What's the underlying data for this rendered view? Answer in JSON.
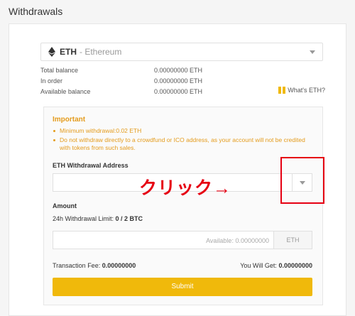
{
  "page": {
    "title": "Withdrawals"
  },
  "coin_select": {
    "code": "ETH",
    "name": "- Ethereum",
    "icon": "ethereum-icon"
  },
  "balances": [
    {
      "label": "Total balance",
      "value": "0.00000000 ETH"
    },
    {
      "label": "In order",
      "value": "0.00000000 ETH"
    },
    {
      "label": "Available balance",
      "value": "0.00000000 ETH"
    }
  ],
  "whats_link": {
    "label": "What's ETH?",
    "icon": "gift-icon"
  },
  "form": {
    "important_title": "Important",
    "notices": [
      "Minimum withdrawal:0.02 ETH",
      "Do not withdraw directly to a crowdfund or ICO address, as your account will not be credited with tokens from such sales."
    ],
    "address_label": "ETH Withdrawal Address",
    "address_value": "",
    "amount_label": "Amount",
    "limit_prefix": "24h Withdrawal Limit: ",
    "limit_value": "0 / 2 BTC",
    "available_text": "Available: 0.00000000",
    "amount_unit": "ETH",
    "fee_label": "Transaction Fee: ",
    "fee_value": "0.00000000",
    "get_label": "You Will Get: ",
    "get_value": "0.00000000",
    "submit_label": "Submit"
  },
  "annotation": {
    "text": "クリック→",
    "color": "#e60012"
  },
  "colors": {
    "accent": "#f0b90b",
    "warning": "#e49b1c",
    "highlight": "#e60012"
  }
}
